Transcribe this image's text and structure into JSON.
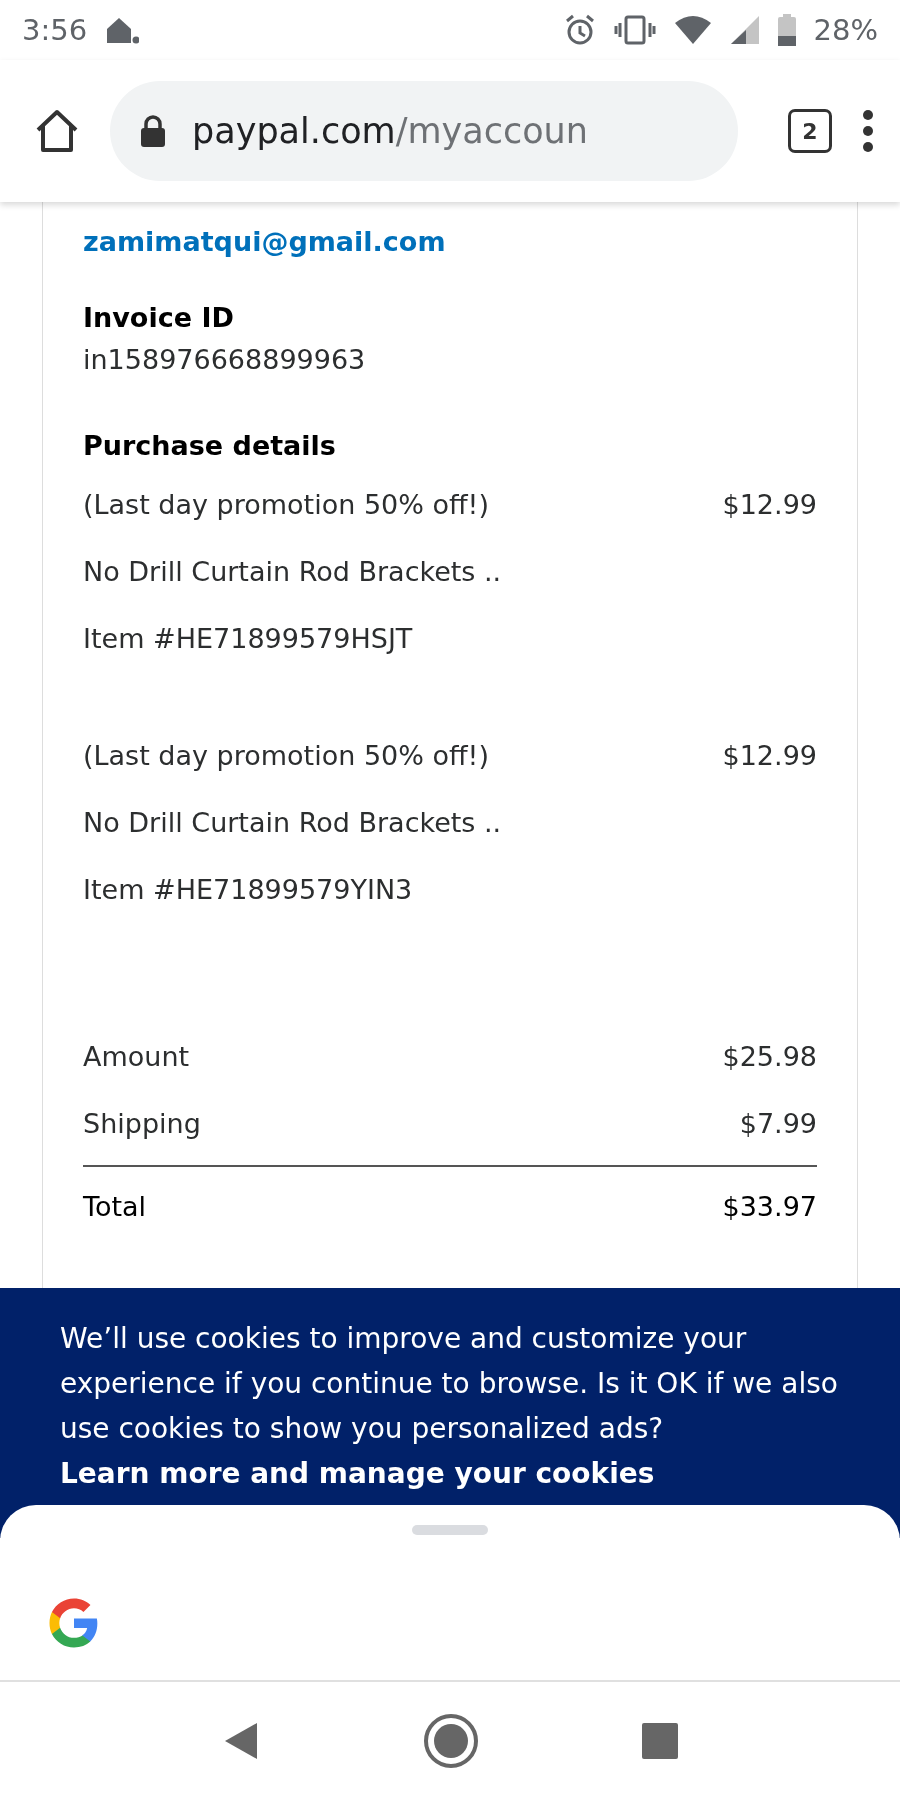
{
  "status_bar": {
    "time": "3:56",
    "battery": "28%"
  },
  "browser": {
    "url_host": "paypal.com",
    "url_path": "/myaccoun",
    "tab_count": "2"
  },
  "invoice": {
    "email": "zamimatqui@gmail.com",
    "invoice_id_label": "Invoice ID",
    "invoice_id": "in158976668899963",
    "purchase_label": "Purchase details",
    "items": [
      {
        "title": "(Last day promotion 50% off!)",
        "price": "$12.99",
        "name": "No Drill Curtain Rod Brackets ..",
        "item_no": "Item #HE71899579HSJT"
      },
      {
        "title": "(Last day promotion 50% off!)",
        "price": "$12.99",
        "name": "No Drill Curtain Rod Brackets ..",
        "item_no": "Item #HE71899579YIN3"
      }
    ],
    "totals": [
      {
        "label": "Amount",
        "value": "$25.98",
        "kind": "line"
      },
      {
        "label": "Shipping",
        "value": "$7.99",
        "kind": "line"
      },
      {
        "label": "Total",
        "value": "$33.97",
        "kind": "total"
      }
    ]
  },
  "cookie_banner": {
    "text": "We’ll use cookies to improve and customize your experience if you continue to browse. Is it OK if we also use cookies to show you personalized ads?",
    "link": "Learn more and manage your cookies"
  }
}
